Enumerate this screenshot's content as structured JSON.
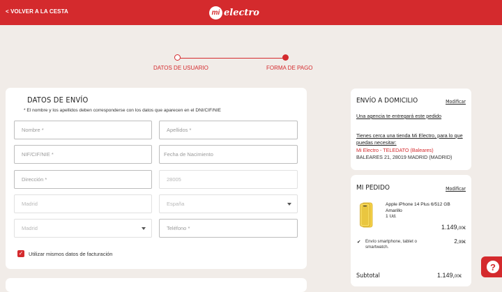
{
  "header": {
    "back_label": "< VOLVER A LA CESTA",
    "logo_mark": "mi",
    "logo_text": "electro"
  },
  "steps": [
    {
      "label": "DATOS DE USUARIO",
      "state": "done"
    },
    {
      "label": "FORMA DE PAGO",
      "state": "current"
    }
  ],
  "shipping_form": {
    "title": "DATOS DE ENVÍO",
    "note": "* El nombre y los apellidos deben corresponderse con los datos que aparecen en el DNI/CIF/NIE",
    "fields": {
      "nombre": {
        "placeholder": "Nombre *"
      },
      "apellidos": {
        "placeholder": "Apellidos *"
      },
      "nif": {
        "placeholder": "NIF/CIF/NIE *"
      },
      "nacimiento": {
        "placeholder": "Fecha de Nacimiento"
      },
      "direccion": {
        "placeholder": "Dirección *"
      },
      "cp": {
        "value": "28005"
      },
      "ciudad": {
        "value": "Madrid"
      },
      "pais": {
        "value": "España"
      },
      "provincia": {
        "value": "Madrid"
      },
      "telefono": {
        "placeholder": "Teléfono *"
      }
    },
    "billing_checkbox": {
      "label": "Utilizar mismos datos de facturación",
      "checked": true
    }
  },
  "delivery": {
    "title": "ENVÍO A DOMICILIO",
    "modify_label": "Modificar",
    "agency_text": "Una agencia te entregará este pedido",
    "store_question": "Tienes cerca una tienda Mi Electro, para lo que puedas necesitar:",
    "store_name": "Mi Electro - TELEDATO (Baleares)",
    "store_address": "BALEARES 21, 28019 MADRID (MADRID)"
  },
  "order": {
    "title": "MI PEDIDO",
    "modify_label": "Modificar",
    "product": {
      "name": "Apple iPhone 14 Plus 6/512 GB",
      "color": "Amarillo",
      "qty": "1 Ud.",
      "price_int": "1.149,",
      "price_dec": "00€"
    },
    "shipping": {
      "check": "✔",
      "text": "Envío smartphone, tablet o smartwatch.",
      "price_int": "2,",
      "price_dec": "99€"
    },
    "subtotal_label": "Subtotal",
    "subtotal_int": "1.149,",
    "subtotal_dec": "00€"
  },
  "colors": {
    "brand_red": "#d42a2d",
    "background": "#f1ece8",
    "product_yellow": "#f6d24a"
  },
  "help_icon": "question-icon"
}
